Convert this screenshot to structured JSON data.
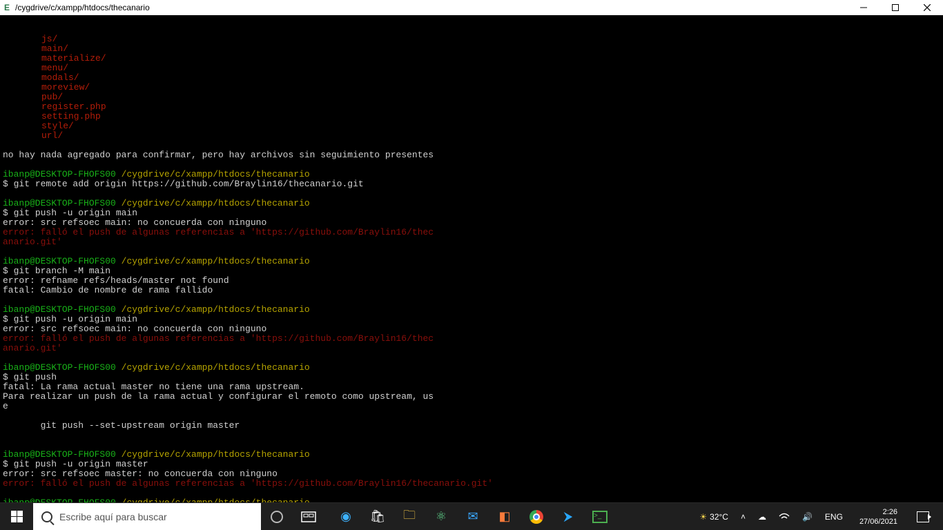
{
  "window_title": "/cygdrive/c/xampp/htdocs/thecanario",
  "listing": [
    "js/",
    "main/",
    "materialize/",
    "menu/",
    "modals/",
    "moreview/",
    "pub/",
    "register.php",
    "setting.php",
    "style/",
    "url/"
  ],
  "msg_noadd": "no hay nada agregado para confirmar, pero hay archivos sin seguimiento presentes",
  "prompt_user": "ibanp@DESKTOP-FHOFS00",
  "prompt_path": "/cygdrive/c/xampp/htdocs/thecanario",
  "cmd_remote_add": "git remote add origin https://github.com/Braylin16/thecanario.git",
  "cmd_push_main": "git push -u origin main",
  "err_src_main": "error: src refsoec main: no concuerda con ninguno",
  "err_push_fail_wrapped_a": "error: falló el push de algunas referencias a 'https://github.com/Braylin16/thec",
  "err_push_fail_wrapped_b": "anario.git'",
  "cmd_branch_m": "git branch -M main",
  "err_refname": "error: refname refs/heads/master not found",
  "fatal_rename": "fatal: Cambio de nombre de rama fallido",
  "cmd_push": "git push",
  "fatal_noupstream": "fatal: La rama actual master no tiene una rama upstream.",
  "msg_upstream_a": "Para realizar un push de la rama actual y configurar el remoto como upstream, us",
  "msg_upstream_b": "e",
  "msg_set_upstream": "       git push --set-upstream origin master",
  "cmd_push_master": "git push -u origin master",
  "err_src_master": "error: src refsoec master: no concuerda con ninguno",
  "err_push_fail_single": "error: falló el push de algunas referencias a 'https://github.com/Braylin16/thecanario.git'",
  "search_placeholder": "Escribe aquí para buscar",
  "tray": {
    "temp": "32°C",
    "lang": "ENG",
    "time": "2:26",
    "date": "27/06/2021"
  }
}
